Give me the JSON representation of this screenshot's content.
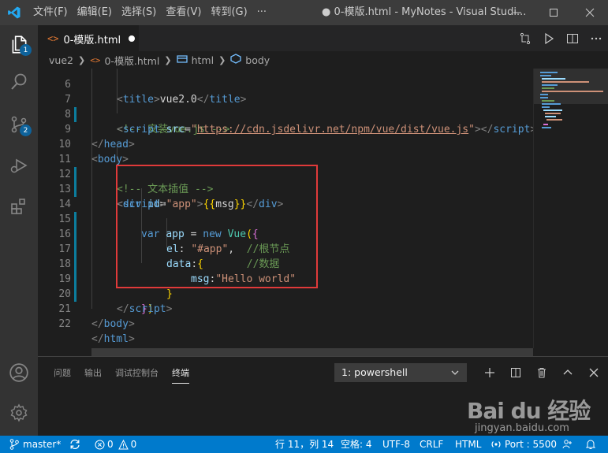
{
  "titlebar": {
    "menu": [
      "文件(F)",
      "编辑(E)",
      "选择(S)",
      "查看(V)",
      "转到(G)",
      "···"
    ],
    "window_title": "● 0-模版.html - MyNotes - Visual Studi..."
  },
  "tab": {
    "label": "0-模版.html",
    "icon": "<>",
    "modified_icon": "circle-dot-icon"
  },
  "breadcrumb": [
    "vue2",
    "0-模版.html",
    "html",
    "body"
  ],
  "activity": {
    "explorer_badge": "1",
    "scm_badge": "2"
  },
  "code_lines": [
    {
      "n": "6"
    },
    {
      "n": "7"
    },
    {
      "n": "8"
    },
    {
      "n": "9"
    },
    {
      "n": "10"
    },
    {
      "n": "11"
    },
    {
      "n": "12"
    },
    {
      "n": "13"
    },
    {
      "n": "14"
    },
    {
      "n": "15"
    },
    {
      "n": "16"
    },
    {
      "n": "17"
    },
    {
      "n": "18"
    },
    {
      "n": "19"
    },
    {
      "n": "20"
    },
    {
      "n": "21"
    },
    {
      "n": "22"
    }
  ],
  "code": {
    "l6_title": "vue2.0",
    "l7_comment": "<!-- 安装vue.js -->",
    "l8_src_url": "https://cdn.jsdelivr.net/npm/vue/dist/vue.js",
    "l11_comment": "<!-- 文本插值 -->",
    "l12_id": "\"app\"",
    "l12_msg": "msg",
    "l15_el_value": "\"#app\"",
    "l15_comment": "//根节点",
    "l16_comment": "//数据",
    "l17_value": "\"Hello world\""
  },
  "panel": {
    "tabs": [
      "问题",
      "输出",
      "调试控制台",
      "终端"
    ],
    "active_tab": "终端",
    "terminal_select": "1: powershell"
  },
  "statusbar": {
    "branch": "master*",
    "errors": "0",
    "warnings": "0",
    "position": "行 11，列 14",
    "indent": "空格: 4",
    "encoding": "UTF-8",
    "eol": "CRLF",
    "language": "HTML",
    "port": "Port : 5500"
  },
  "watermark": {
    "logo_text": "Bai du 经验",
    "sub": "jingyan.baidu.com"
  },
  "colors": {
    "accent": "#007acc",
    "highlight_box": "#e03a3a"
  }
}
